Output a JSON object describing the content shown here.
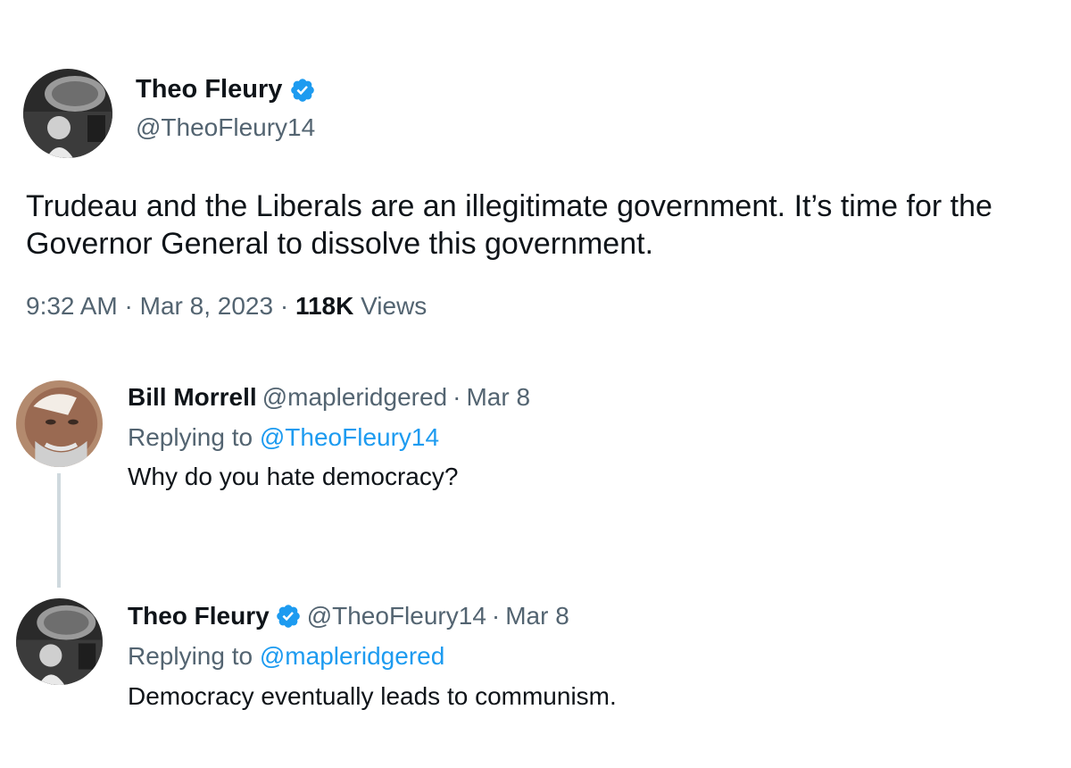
{
  "main_tweet": {
    "author_name": "Theo Fleury",
    "author_handle": "@TheoFleury14",
    "text": "Trudeau and the Liberals are an illegitimate government. It’s time for the Governor General to dissolve this government.",
    "time": "9:32 AM",
    "separator": "·",
    "date": "Mar 8, 2023",
    "views_count": "118K",
    "views_label": "Views"
  },
  "replies": [
    {
      "author_name": "Bill Morrell",
      "author_handle": "@mapleridgered",
      "separator": "·",
      "date": "Mar 8",
      "replying_prefix": "Replying to",
      "replying_to": "@TheoFleury14",
      "text": "Why do you hate democracy?",
      "verified": false
    },
    {
      "author_name": "Theo Fleury",
      "author_handle": "@TheoFleury14",
      "separator": "·",
      "date": "Mar 8",
      "replying_prefix": "Replying to",
      "replying_to": "@mapleridgered",
      "text": "Democracy eventually leads to communism.",
      "verified": true
    }
  ],
  "colors": {
    "text_primary": "#0f1419",
    "text_secondary": "#536471",
    "link": "#1d9bf0",
    "verified_badge": "#1d9bf0",
    "thread_line": "#cfd9de"
  },
  "icons": {
    "verified": "verified-badge-icon",
    "avatar_theo": "avatar-theo-fleury",
    "avatar_bill": "avatar-bill-morrell"
  }
}
